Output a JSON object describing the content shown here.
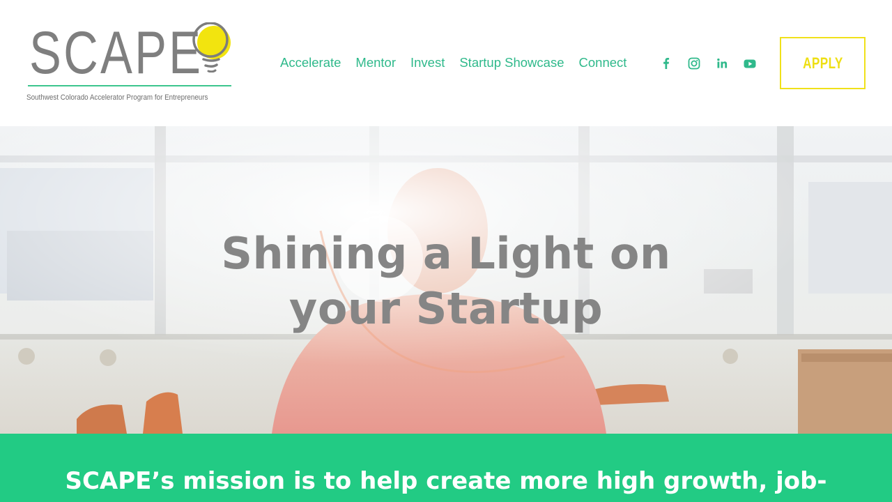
{
  "brand": {
    "logo_word": "SCAPE",
    "tagline": "Southwest Colorado Accelerator Program for Entrepreneurs"
  },
  "nav": {
    "items": [
      "Accelerate",
      "Mentor",
      "Invest",
      "Startup Showcase",
      "Connect"
    ]
  },
  "social": {
    "icons": [
      "facebook-icon",
      "instagram-icon",
      "linkedin-icon",
      "youtube-icon"
    ]
  },
  "header": {
    "apply_label": "APPLY"
  },
  "hero": {
    "title_line1": "Shining a Light on",
    "title_line2": "your Startup"
  },
  "mission": {
    "text": "SCAPE’s mission is to help create more high growth, job-"
  },
  "colors": {
    "accent_green": "#22cb84",
    "nav_green": "#2fb98b",
    "apply_yellow": "#f0e11a",
    "logo_gray": "#7f7f7f",
    "hero_title_gray": "#858585"
  }
}
